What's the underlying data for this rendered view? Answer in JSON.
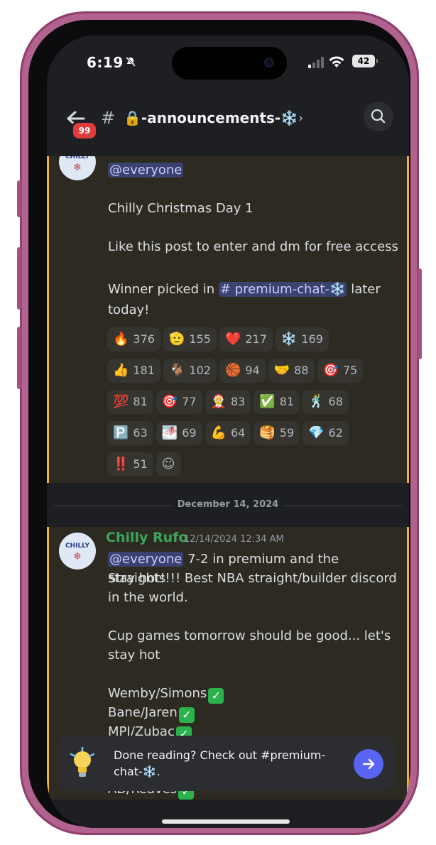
{
  "status_bar": {
    "time": "6:19",
    "battery": "42"
  },
  "header": {
    "unread_count": "99",
    "channel_name": "🔒-announcements-❄️",
    "chevron": "›"
  },
  "message1": {
    "mention": "@everyone",
    "line1": "Chilly Christmas Day 1",
    "line2": "Like this post to enter and dm for free access",
    "line3_prefix": "Winner picked in ",
    "channel_ref": "# premium-chat-❄️",
    "line3_suffix": " later",
    "line4": "today!",
    "reactions": [
      {
        "emoji": "🔥",
        "count": "376"
      },
      {
        "emoji": "🫡",
        "count": "155"
      },
      {
        "emoji": "❤️",
        "count": "217"
      },
      {
        "emoji": "❄️",
        "count": "169"
      },
      {
        "emoji": "👍",
        "count": "181"
      },
      {
        "emoji": "🐐",
        "count": "102"
      },
      {
        "emoji": "🏀",
        "count": "94"
      },
      {
        "emoji": "🤝",
        "count": "88"
      },
      {
        "emoji": "🎯",
        "count": "75"
      },
      {
        "emoji": "💯",
        "count": "81"
      },
      {
        "emoji": "🎯",
        "count": "77"
      },
      {
        "emoji": "🤶",
        "count": "83"
      },
      {
        "emoji": "✅",
        "count": "81"
      },
      {
        "emoji": "🕺",
        "count": "68"
      },
      {
        "emoji": "🅿️",
        "count": "63"
      },
      {
        "emoji": "🌁",
        "count": "69"
      },
      {
        "emoji": "💪",
        "count": "64"
      },
      {
        "emoji": "🥞",
        "count": "59"
      },
      {
        "emoji": "💎",
        "count": "62"
      },
      {
        "emoji": "‼️",
        "count": "51"
      },
      {
        "emoji": "☺",
        "count": ""
      }
    ]
  },
  "date_divider": "December 14, 2024",
  "message2": {
    "author": "Chilly Rufo",
    "timestamp": "12/14/2024 12:34 AM",
    "mention": "@everyone",
    "line1": " 7-2 in premium and the Straights",
    "line2": "stay hot!!!! Best NBA straight/builder discord",
    "line3": "in the world.",
    "line4": "Cup games tomorrow should be good... let's",
    "line5": "stay hot",
    "pick1": "Wemby/Simons",
    "pick2": "Bane/Jaren",
    "pick3": "MPJ/Zubac",
    "pick4": "AD/Reaves"
  },
  "avatar_label": "CHILLY",
  "banner": {
    "text": "Done reading? Check out #premium-chat-❄️."
  },
  "colors": {
    "accent": "#5865f2",
    "highlight_border": "#f0b232",
    "author": "#3ba55d",
    "badge": "#e03c3c"
  }
}
